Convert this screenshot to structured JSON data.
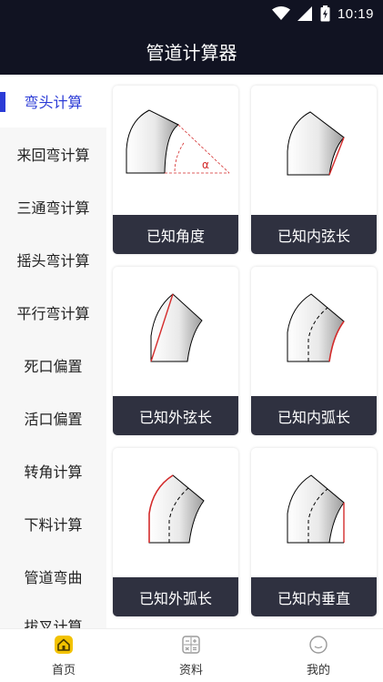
{
  "status": {
    "time": "10:19",
    "icons": [
      "wifi-icon",
      "signal-icon",
      "battery-icon"
    ]
  },
  "header": {
    "title": "管道计算器"
  },
  "sidebar": {
    "items": [
      {
        "label": "弯头计算",
        "active": true
      },
      {
        "label": "来回弯计算"
      },
      {
        "label": "三通弯计算"
      },
      {
        "label": "摇头弯计算"
      },
      {
        "label": "平行弯计算"
      },
      {
        "label": "死口偏置"
      },
      {
        "label": "活口偏置"
      },
      {
        "label": "转角计算"
      },
      {
        "label": "下料计算"
      },
      {
        "label": "管道弯曲"
      },
      {
        "label": "拔叉计算"
      }
    ]
  },
  "cards": [
    {
      "label": "已知角度",
      "figure_text": "α"
    },
    {
      "label": "已知内弦长"
    },
    {
      "label": "已知外弦长"
    },
    {
      "label": "已知内弧长"
    },
    {
      "label": "已知外弧长"
    },
    {
      "label": "已知内垂直"
    }
  ],
  "bottom_nav": {
    "items": [
      {
        "label": "首页",
        "icon": "home-icon",
        "active": true
      },
      {
        "label": "资料",
        "icon": "calculator-icon"
      },
      {
        "label": "我的",
        "icon": "user-face-icon"
      }
    ]
  },
  "colors": {
    "accent": "#2b3bd6",
    "header_bg": "#111322",
    "highlight_red": "#d42b2b",
    "card_label_bg": "#2f3140",
    "home_icon": "#f2c200"
  }
}
